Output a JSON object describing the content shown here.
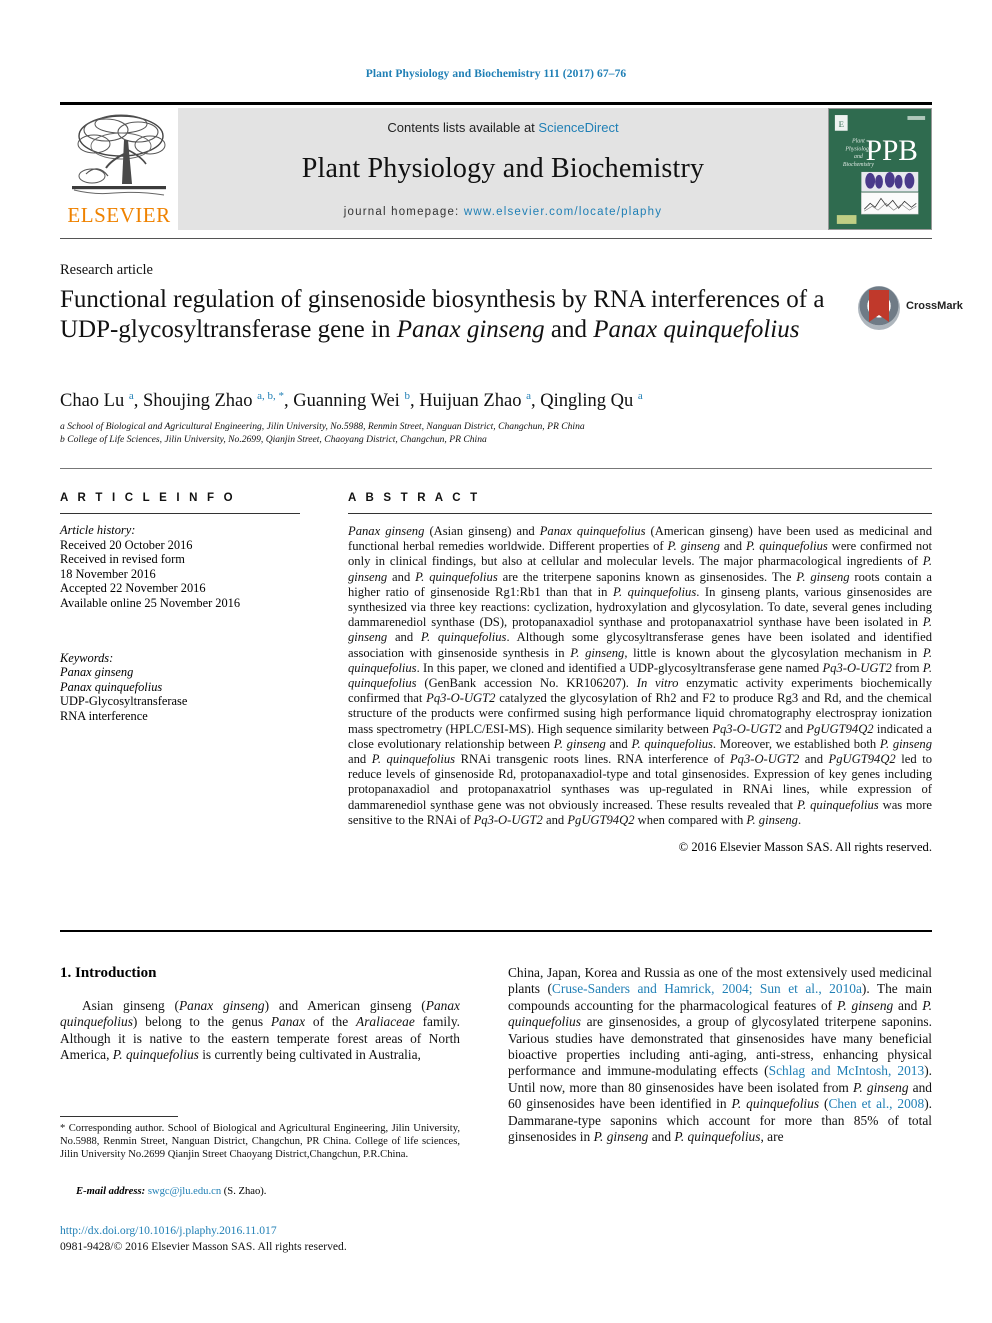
{
  "runhead": "Plant Physiology and Biochemistry 111 (2017) 67–76",
  "masthead": {
    "publisher_name": "ELSEVIER",
    "contents_prefix": "Contents lists available at ",
    "contents_link": "ScienceDirect",
    "journal_title": "Plant Physiology and Biochemistry",
    "homepage_prefix": "journal homepage: ",
    "homepage_link": "www.elsevier.com/locate/plaphy",
    "cover_abbrev": "PPB",
    "cover_tagline": "Plant Physiology and Biochemistry"
  },
  "article": {
    "type": "Research article",
    "title_part1": "Functional regulation of ginsenoside biosynthesis by RNA interferences of a UDP-glycosyltransferase gene in ",
    "title_italic1": "Panax ginseng",
    "title_part2": " and ",
    "title_italic2": "Panax quinquefolius",
    "crossmark_label": "CrossMark"
  },
  "authors": {
    "list": "Chao Lu a, Shoujing Zhao a, b, *, Guanning Wei b, Huijuan Zhao a, Qingling Qu a",
    "affiliation_a": "a School of Biological and Agricultural Engineering, Jilin University, No.5988, Renmin Street, Nanguan District, Changchun, PR China",
    "affiliation_b": "b College of Life Sciences, Jilin University, No.2699, Qianjin Street, Chaoyang District, Changchun, PR China"
  },
  "article_info": {
    "heading": "A R T I C L E   I N F O",
    "history_label": "Article history:",
    "history": [
      "Received 20 October 2016",
      "Received in revised form",
      "18 November 2016",
      "Accepted 22 November 2016",
      "Available online 25 November 2016"
    ],
    "keywords_label": "Keywords:",
    "keywords": [
      "Panax ginseng",
      "Panax quinquefolius",
      "UDP-Glycosyltransferase",
      "RNA interference"
    ]
  },
  "abstract": {
    "heading": "A B S T R A C T",
    "text": "Panax ginseng (Asian ginseng) and Panax quinquefolius (American ginseng) have been used as medicinal and functional herbal remedies worldwide. Different properties of P. ginseng and P. quinquefolius were confirmed not only in clinical findings, but also at cellular and molecular levels. The major pharmacological ingredients of P. ginseng and P. quinquefolius are the triterpene saponins known as ginsenosides. The P. ginseng roots contain a higher ratio of ginsenoside Rg1:Rb1 than that in P. quinquefolius. In ginseng plants, various ginsenosides are synthesized via three key reactions: cyclization, hydroxylation and glycosylation. To date, several genes including dammarenediol synthase (DS), protopanaxadiol synthase and protopanaxatriol synthase have been isolated in P. ginseng and P. quinquefolius. Although some glycosyltransferase genes have been isolated and identified association with ginsenoside synthesis in P. ginseng, little is known about the glycosylation mechanism in P. quinquefolius. In this paper, we cloned and identified a UDP-glycosyltransferase gene named Pq3-O-UGT2 from P. quinquefolius (GenBank accession No. KR106207). In vitro enzymatic activity experiments biochemically confirmed that Pq3-O-UGT2 catalyzed the glycosylation of Rh2 and F2 to produce Rg3 and Rd, and the chemical structure of the products were confirmed susing high performance liquid chromatography electrospray ionization mass spectrometry (HPLC/ESI-MS). High sequence similarity between Pq3-O-UGT2 and PgUGT94Q2 indicated a close evolutionary relationship between P. ginseng and P. quinquefolius. Moreover, we established both P. ginseng and P. quinquefolius RNAi transgenic roots lines. RNA interference of Pq3-O-UGT2 and PgUGT94Q2 led to reduce levels of ginsenoside Rd, protopanaxadiol-type and total ginsenosides. Expression of key genes including protopanaxadiol and protopanaxatriol synthases was up-regulated in RNAi lines, while expression of dammarenediol synthase gene was not obviously increased. These results revealed that P. quinquefolius was more sensitive to the RNAi of Pq3-O-UGT2 and PgUGT94Q2 when compared with P. ginseng.",
    "copyright": "© 2016 Elsevier Masson SAS. All rights reserved."
  },
  "introduction": {
    "heading": "1. Introduction",
    "left_paragraph": "Asian ginseng (Panax ginseng) and American ginseng (Panax quinquefolius) belong to the genus Panax of the Araliaceae family. Although it is native to the eastern temperate forest areas of North America, P. quinquefolius is currently being cultivated in Australia,",
    "right_paragraph": "China, Japan, Korea and Russia as one of the most extensively used medicinal plants (Cruse-Sanders and Hamrick, 2004; Sun et al., 2010a). The main compounds accounting for the pharmacological features of P. ginseng and P. quinquefolius are ginsenosides, a group of glycosylated triterpene saponins. Various studies have demonstrated that ginsenosides have many beneficial bioactive properties including anti-aging, anti-stress, enhancing physical performance and immune-modulating effects (Schlag and McIntosh, 2013). Until now, more than 80 ginsenosides have been isolated from P. ginseng and 60 ginsenosides have been identified in P. quinquefolius (Chen et al., 2008). Dammarane-type saponins which account for more than 85% of total ginsenosides in P. ginseng and P. quinquefolius, are",
    "citations": [
      "Cruse-Sanders and Hamrick, 2004; Sun et al., 2010a",
      "Schlag and McIntosh, 2013",
      "Chen et al., 2008"
    ]
  },
  "footer": {
    "corresponding_marker": "*",
    "corresponding_note": "Corresponding author. School of Biological and Agricultural Engineering, Jilin University, No.5988, Renmin Street, Nanguan District, Changchun, PR China. College of life sciences, Jilin University No.2699 Qianjin Street Chaoyang District,Changchun, P.R.China.",
    "email_label": "E-mail address:",
    "email": "swgc@jlu.edu.cn",
    "email_suffix": "(S. Zhao).",
    "doi": "http://dx.doi.org/10.1016/j.plaphy.2016.11.017",
    "issn_line": "0981-9428/© 2016 Elsevier Masson SAS. All rights reserved."
  },
  "colors": {
    "link": "#1f7fb5",
    "elsevier_orange": "#ef8200",
    "masthead_bg": "#e3e3e3",
    "cover_green": "#2f6b4f"
  }
}
